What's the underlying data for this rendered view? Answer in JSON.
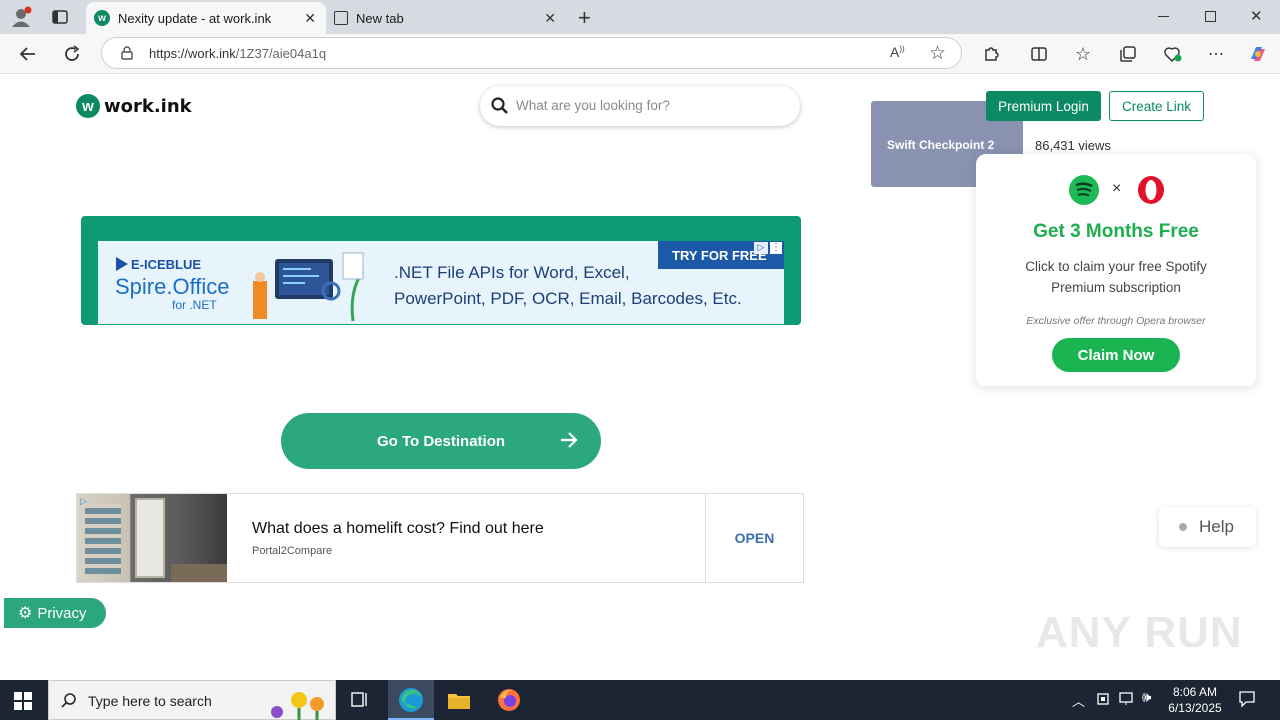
{
  "browser": {
    "tabs": [
      {
        "title": "Nexity update - at work.ink",
        "active": true
      },
      {
        "title": "New tab",
        "active": false
      }
    ],
    "url_host": "https://work.ink",
    "url_path": "/1Z37/aie04a1q",
    "icons": {
      "back": "back-arrow-icon",
      "reload": "reload-icon",
      "site_info": "site-info-icon",
      "read_aloud": "read-aloud-icon",
      "favorite": "star-icon",
      "extensions": "extensions-icon",
      "split": "split-screen-icon",
      "favorites": "favorites-icon",
      "collections": "collections-icon",
      "vpn": "browser-essentials-icon",
      "menu": "more-icon",
      "copilot": "copilot-icon"
    }
  },
  "header": {
    "logo_text": "work.ink",
    "search_placeholder": "What are you looking for?",
    "premium_login": "Premium Login",
    "create_link": "Create Link"
  },
  "side_card": {
    "title": "Swift Checkpoint 2",
    "views": "86,431 views"
  },
  "ad1": {
    "brand_top": "E-ICEBLUE",
    "brand_main": "Spire.Office",
    "brand_sub": "for .NET",
    "line1": ".NET File APIs for Word, Excel,",
    "line2": "PowerPoint, PDF, OCR, Email, Barcodes, Etc.",
    "cta": "TRY FOR FREE"
  },
  "main": {
    "goto_label": "Go To Destination"
  },
  "ad2": {
    "headline": "What does a homelift cost? Find out here",
    "source": "Portal2Compare",
    "open_label": "OPEN"
  },
  "privacy": {
    "label": "Privacy"
  },
  "popup": {
    "times": "×",
    "title": "Get 3 Months Free",
    "body": "Click to claim your free Spotify Premium subscription",
    "note": "Exclusive offer through Opera browser",
    "cta": "Claim Now"
  },
  "help": {
    "label": "Help"
  },
  "watermark": "ANY RUN",
  "taskbar": {
    "search_placeholder": "Type here to search",
    "time": "8:06 AM",
    "date": "6/13/2025"
  },
  "colors": {
    "brand_green": "#0b8a63",
    "accent_green": "#2ca881",
    "spotify_green": "#1db954",
    "opera_red": "#e0132b"
  }
}
